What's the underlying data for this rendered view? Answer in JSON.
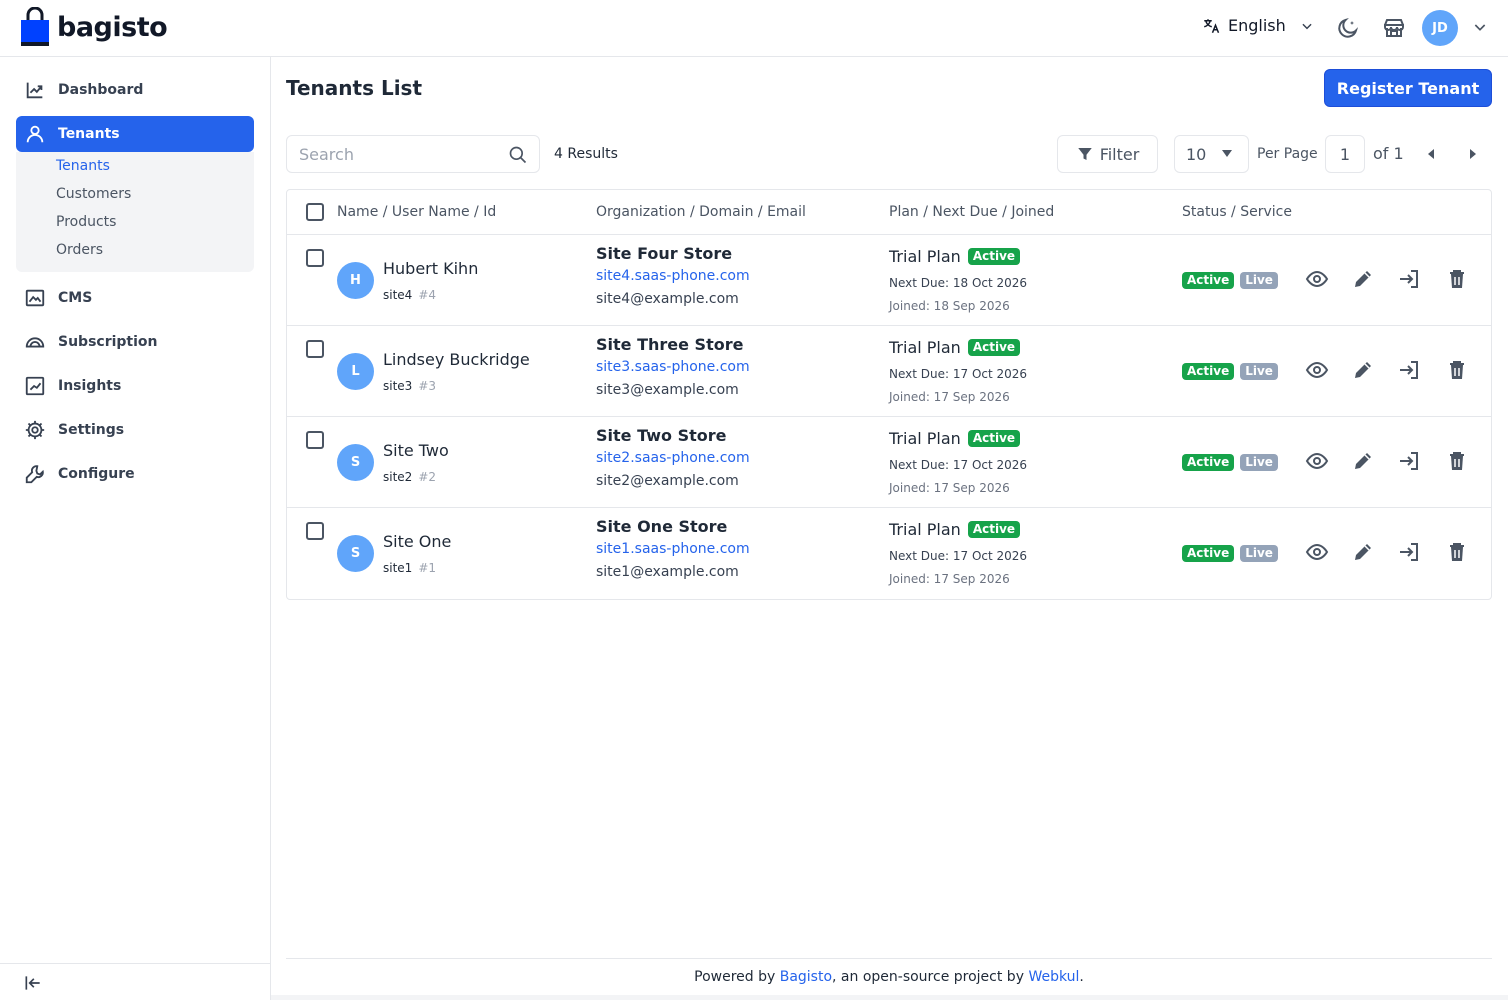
{
  "brand": {
    "name": "bagisto",
    "color": "#0041ff"
  },
  "header": {
    "language": "English",
    "user_initials": "JD",
    "icons": [
      "translate-icon",
      "chevron-down-icon",
      "dark-mode-icon",
      "storefront-icon",
      "chevron-down-icon"
    ]
  },
  "sidebar": {
    "items": [
      {
        "label": "Dashboard",
        "icon": "dashboard-icon"
      },
      {
        "label": "Tenants",
        "icon": "user-icon",
        "active": true
      },
      {
        "label": "CMS",
        "icon": "cms-icon"
      },
      {
        "label": "Subscription",
        "icon": "subscription-icon"
      },
      {
        "label": "Insights",
        "icon": "insights-icon"
      },
      {
        "label": "Settings",
        "icon": "gear-icon"
      },
      {
        "label": "Configure",
        "icon": "wrench-icon"
      }
    ],
    "submenu": [
      {
        "label": "Tenants",
        "active": true
      },
      {
        "label": "Customers"
      },
      {
        "label": "Products"
      },
      {
        "label": "Orders"
      }
    ]
  },
  "page": {
    "title": "Tenants List",
    "register_label": "Register Tenant"
  },
  "toolbar": {
    "search_placeholder": "Search",
    "results": "4 Results",
    "filter_label": "Filter",
    "per_page_value": "10",
    "per_page_label": "Per Page",
    "current_page": "1",
    "of_pages": "of 1"
  },
  "table": {
    "headers": [
      "Name / User Name / Id",
      "Organization / Domain / Email",
      "Plan / Next Due / Joined",
      "Status / Service"
    ],
    "rows": [
      {
        "initial": "H",
        "name": "Hubert Kihn",
        "username": "site4",
        "id": "#4",
        "org": "Site Four Store",
        "domain": "site4.saas-phone.com",
        "email": "site4@example.com",
        "plan": "Trial Plan",
        "plan_status": "Active",
        "next_due": "Next Due: 18 Oct 2026",
        "joined": "Joined: 18 Sep 2026",
        "status": "Active",
        "service": "Live"
      },
      {
        "initial": "L",
        "name": "Lindsey Buckridge",
        "username": "site3",
        "id": "#3",
        "org": "Site Three Store",
        "domain": "site3.saas-phone.com",
        "email": "site3@example.com",
        "plan": "Trial Plan",
        "plan_status": "Active",
        "next_due": "Next Due: 17 Oct 2026",
        "joined": "Joined: 17 Sep 2026",
        "status": "Active",
        "service": "Live"
      },
      {
        "initial": "S",
        "name": "Site Two",
        "username": "site2",
        "id": "#2",
        "org": "Site Two Store",
        "domain": "site2.saas-phone.com",
        "email": "site2@example.com",
        "plan": "Trial Plan",
        "plan_status": "Active",
        "next_due": "Next Due: 17 Oct 2026",
        "joined": "Joined: 17 Sep 2026",
        "status": "Active",
        "service": "Live"
      },
      {
        "initial": "S",
        "name": "Site One",
        "username": "site1",
        "id": "#1",
        "org": "Site One Store",
        "domain": "site1.saas-phone.com",
        "email": "site1@example.com",
        "plan": "Trial Plan",
        "plan_status": "Active",
        "next_due": "Next Due: 17 Oct 2026",
        "joined": "Joined: 17 Sep 2026",
        "status": "Active",
        "service": "Live"
      }
    ],
    "actions": [
      "view-icon",
      "edit-icon",
      "login-icon",
      "delete-icon"
    ]
  },
  "footer": {
    "prefix": "Powered by ",
    "link1": "Bagisto",
    "middle": ", an open-source project by ",
    "link2": "Webkul",
    "suffix": "."
  },
  "colors": {
    "primary": "#2563eb",
    "success": "#16a34a",
    "muted_badge": "#94a3b8",
    "avatar": "#60a5fa"
  }
}
